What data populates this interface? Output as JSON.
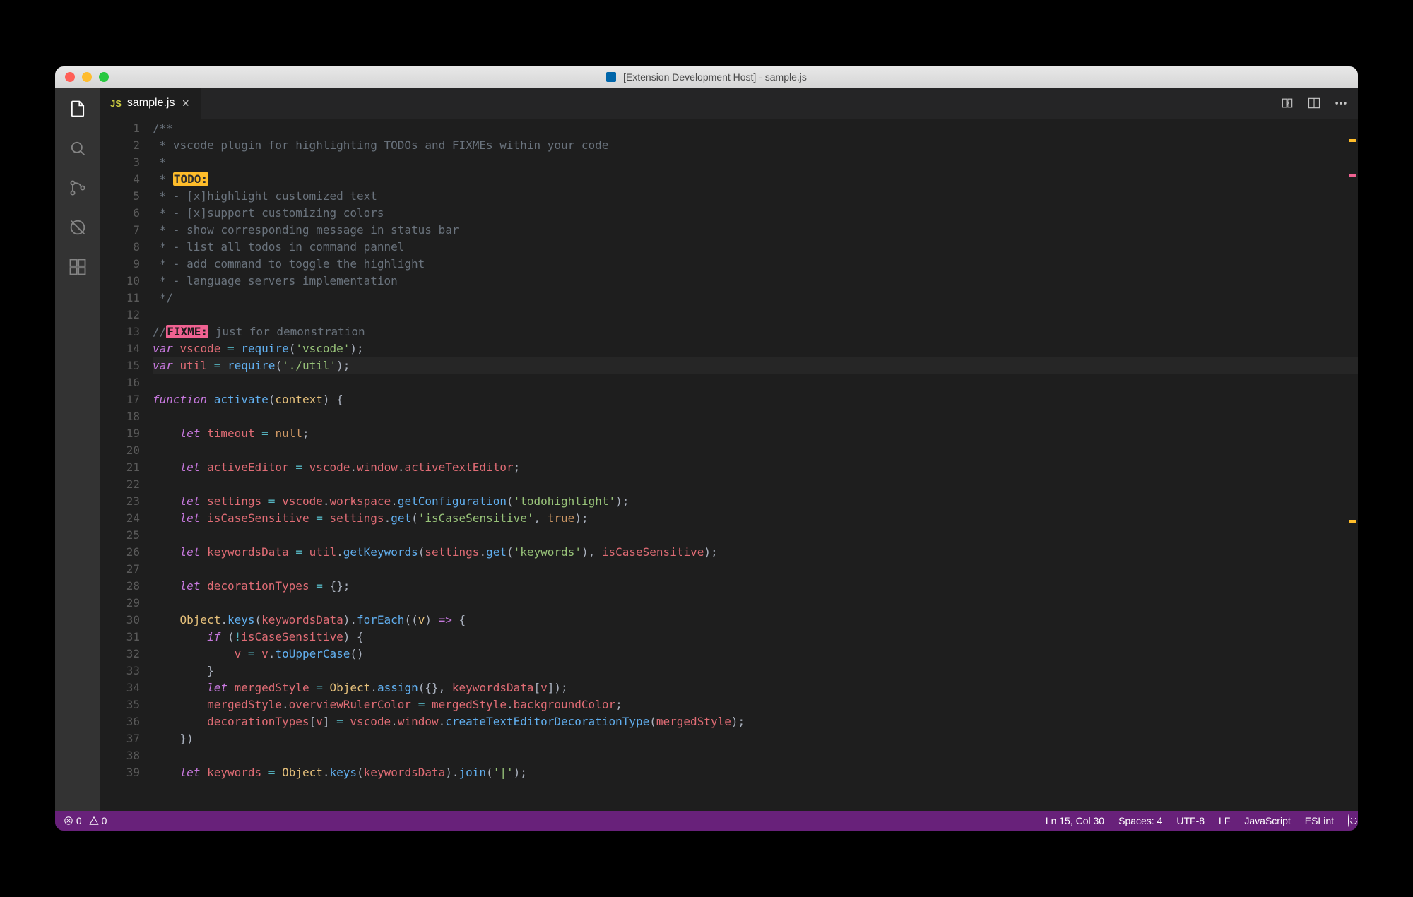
{
  "window": {
    "title": "[Extension Development Host] - sample.js"
  },
  "activitybar": {
    "items": [
      {
        "name": "explorer-icon"
      },
      {
        "name": "search-icon"
      },
      {
        "name": "source-control-icon"
      },
      {
        "name": "debug-icon"
      },
      {
        "name": "extensions-icon"
      }
    ]
  },
  "tabs": [
    {
      "icon": "JS",
      "label": "sample.js",
      "active": true
    }
  ],
  "editor_actions": [
    "compare-icon",
    "split-icon",
    "more-icon"
  ],
  "editor": {
    "current_line": 15,
    "lines": [
      {
        "n": 1,
        "tokens": [
          [
            "comment",
            "/**"
          ]
        ]
      },
      {
        "n": 2,
        "tokens": [
          [
            "comment",
            " * vscode plugin for highlighting TODOs and FIXMEs within your code"
          ]
        ]
      },
      {
        "n": 3,
        "tokens": [
          [
            "comment",
            " *"
          ]
        ]
      },
      {
        "n": 4,
        "tokens": [
          [
            "comment",
            " * "
          ],
          [
            "todo",
            "TODO:"
          ]
        ]
      },
      {
        "n": 5,
        "tokens": [
          [
            "comment",
            " * - [x]highlight customized text"
          ]
        ]
      },
      {
        "n": 6,
        "tokens": [
          [
            "comment",
            " * - [x]support customizing colors"
          ]
        ]
      },
      {
        "n": 7,
        "tokens": [
          [
            "comment",
            " * - show corresponding message in status bar"
          ]
        ]
      },
      {
        "n": 8,
        "tokens": [
          [
            "comment",
            " * - list all todos in command pannel"
          ]
        ]
      },
      {
        "n": 9,
        "tokens": [
          [
            "comment",
            " * - add command to toggle the highlight"
          ]
        ]
      },
      {
        "n": 10,
        "tokens": [
          [
            "comment",
            " * - language servers implementation"
          ]
        ]
      },
      {
        "n": 11,
        "tokens": [
          [
            "comment",
            " */"
          ]
        ]
      },
      {
        "n": 12,
        "tokens": []
      },
      {
        "n": 13,
        "tokens": [
          [
            "comment",
            "//"
          ],
          [
            "fixme",
            "FIXME:"
          ],
          [
            "comment",
            " just for demonstration"
          ]
        ]
      },
      {
        "n": 14,
        "tokens": [
          [
            "kw",
            "var"
          ],
          [
            "p",
            " "
          ],
          [
            "id",
            "vscode"
          ],
          [
            "p",
            " "
          ],
          [
            "op",
            "="
          ],
          [
            "p",
            " "
          ],
          [
            "fn",
            "require"
          ],
          [
            "p",
            "("
          ],
          [
            "str",
            "'vscode'"
          ],
          [
            "p",
            ");"
          ]
        ]
      },
      {
        "n": 15,
        "tokens": [
          [
            "kw",
            "var"
          ],
          [
            "p",
            " "
          ],
          [
            "id",
            "util"
          ],
          [
            "p",
            " "
          ],
          [
            "op",
            "="
          ],
          [
            "p",
            " "
          ],
          [
            "fn",
            "require"
          ],
          [
            "p",
            "("
          ],
          [
            "str",
            "'./util'"
          ],
          [
            "p",
            ");"
          ]
        ]
      },
      {
        "n": 16,
        "tokens": []
      },
      {
        "n": 17,
        "tokens": [
          [
            "kw",
            "function"
          ],
          [
            "p",
            " "
          ],
          [
            "fn",
            "activate"
          ],
          [
            "p",
            "("
          ],
          [
            "param",
            "context"
          ],
          [
            "p",
            ") {"
          ]
        ]
      },
      {
        "n": 18,
        "tokens": []
      },
      {
        "n": 19,
        "tokens": [
          [
            "p",
            "    "
          ],
          [
            "kw",
            "let"
          ],
          [
            "p",
            " "
          ],
          [
            "id",
            "timeout"
          ],
          [
            "p",
            " "
          ],
          [
            "op",
            "="
          ],
          [
            "p",
            " "
          ],
          [
            "lit",
            "null"
          ],
          [
            "p",
            ";"
          ]
        ]
      },
      {
        "n": 20,
        "tokens": []
      },
      {
        "n": 21,
        "tokens": [
          [
            "p",
            "    "
          ],
          [
            "kw",
            "let"
          ],
          [
            "p",
            " "
          ],
          [
            "id",
            "activeEditor"
          ],
          [
            "p",
            " "
          ],
          [
            "op",
            "="
          ],
          [
            "p",
            " "
          ],
          [
            "id",
            "vscode"
          ],
          [
            "p",
            "."
          ],
          [
            "id",
            "window"
          ],
          [
            "p",
            "."
          ],
          [
            "id",
            "activeTextEditor"
          ],
          [
            "p",
            ";"
          ]
        ]
      },
      {
        "n": 22,
        "tokens": []
      },
      {
        "n": 23,
        "tokens": [
          [
            "p",
            "    "
          ],
          [
            "kw",
            "let"
          ],
          [
            "p",
            " "
          ],
          [
            "id",
            "settings"
          ],
          [
            "p",
            " "
          ],
          [
            "op",
            "="
          ],
          [
            "p",
            " "
          ],
          [
            "id",
            "vscode"
          ],
          [
            "p",
            "."
          ],
          [
            "id",
            "workspace"
          ],
          [
            "p",
            "."
          ],
          [
            "fn",
            "getConfiguration"
          ],
          [
            "p",
            "("
          ],
          [
            "str",
            "'todohighlight'"
          ],
          [
            "p",
            ");"
          ]
        ]
      },
      {
        "n": 24,
        "tokens": [
          [
            "p",
            "    "
          ],
          [
            "kw",
            "let"
          ],
          [
            "p",
            " "
          ],
          [
            "id",
            "isCaseSensitive"
          ],
          [
            "p",
            " "
          ],
          [
            "op",
            "="
          ],
          [
            "p",
            " "
          ],
          [
            "id",
            "settings"
          ],
          [
            "p",
            "."
          ],
          [
            "fn",
            "get"
          ],
          [
            "p",
            "("
          ],
          [
            "str",
            "'isCaseSensitive'"
          ],
          [
            "p",
            ", "
          ],
          [
            "lit",
            "true"
          ],
          [
            "p",
            ");"
          ]
        ]
      },
      {
        "n": 25,
        "tokens": []
      },
      {
        "n": 26,
        "tokens": [
          [
            "p",
            "    "
          ],
          [
            "kw",
            "let"
          ],
          [
            "p",
            " "
          ],
          [
            "id",
            "keywordsData"
          ],
          [
            "p",
            " "
          ],
          [
            "op",
            "="
          ],
          [
            "p",
            " "
          ],
          [
            "id",
            "util"
          ],
          [
            "p",
            "."
          ],
          [
            "fn",
            "getKeywords"
          ],
          [
            "p",
            "("
          ],
          [
            "id",
            "settings"
          ],
          [
            "p",
            "."
          ],
          [
            "fn",
            "get"
          ],
          [
            "p",
            "("
          ],
          [
            "str",
            "'keywords'"
          ],
          [
            "p",
            "), "
          ],
          [
            "id",
            "isCaseSensitive"
          ],
          [
            "p",
            ");"
          ]
        ]
      },
      {
        "n": 27,
        "tokens": []
      },
      {
        "n": 28,
        "tokens": [
          [
            "p",
            "    "
          ],
          [
            "kw",
            "let"
          ],
          [
            "p",
            " "
          ],
          [
            "id",
            "decorationTypes"
          ],
          [
            "p",
            " "
          ],
          [
            "op",
            "="
          ],
          [
            "p",
            " {};"
          ]
        ]
      },
      {
        "n": 29,
        "tokens": []
      },
      {
        "n": 30,
        "tokens": [
          [
            "p",
            "    "
          ],
          [
            "id2",
            "Object"
          ],
          [
            "p",
            "."
          ],
          [
            "fn",
            "keys"
          ],
          [
            "p",
            "("
          ],
          [
            "id",
            "keywordsData"
          ],
          [
            "p",
            ")."
          ],
          [
            "fn",
            "forEach"
          ],
          [
            "p",
            "(("
          ],
          [
            "param",
            "v"
          ],
          [
            "p",
            ") "
          ],
          [
            "kw",
            "=>"
          ],
          [
            "p",
            " {"
          ]
        ]
      },
      {
        "n": 31,
        "tokens": [
          [
            "p",
            "        "
          ],
          [
            "kw",
            "if"
          ],
          [
            "p",
            " ("
          ],
          [
            "op",
            "!"
          ],
          [
            "id",
            "isCaseSensitive"
          ],
          [
            "p",
            ") {"
          ]
        ]
      },
      {
        "n": 32,
        "tokens": [
          [
            "p",
            "            "
          ],
          [
            "id",
            "v"
          ],
          [
            "p",
            " "
          ],
          [
            "op",
            "="
          ],
          [
            "p",
            " "
          ],
          [
            "id",
            "v"
          ],
          [
            "p",
            "."
          ],
          [
            "fn",
            "toUpperCase"
          ],
          [
            "p",
            "()"
          ]
        ]
      },
      {
        "n": 33,
        "tokens": [
          [
            "p",
            "        }"
          ]
        ]
      },
      {
        "n": 34,
        "tokens": [
          [
            "p",
            "        "
          ],
          [
            "kw",
            "let"
          ],
          [
            "p",
            " "
          ],
          [
            "id",
            "mergedStyle"
          ],
          [
            "p",
            " "
          ],
          [
            "op",
            "="
          ],
          [
            "p",
            " "
          ],
          [
            "id2",
            "Object"
          ],
          [
            "p",
            "."
          ],
          [
            "fn",
            "assign"
          ],
          [
            "p",
            "({}, "
          ],
          [
            "id",
            "keywordsData"
          ],
          [
            "p",
            "["
          ],
          [
            "id",
            "v"
          ],
          [
            "p",
            "]);"
          ]
        ]
      },
      {
        "n": 35,
        "tokens": [
          [
            "p",
            "        "
          ],
          [
            "id",
            "mergedStyle"
          ],
          [
            "p",
            "."
          ],
          [
            "id",
            "overviewRulerColor"
          ],
          [
            "p",
            " "
          ],
          [
            "op",
            "="
          ],
          [
            "p",
            " "
          ],
          [
            "id",
            "mergedStyle"
          ],
          [
            "p",
            "."
          ],
          [
            "id",
            "backgroundColor"
          ],
          [
            "p",
            ";"
          ]
        ]
      },
      {
        "n": 36,
        "tokens": [
          [
            "p",
            "        "
          ],
          [
            "id",
            "decorationTypes"
          ],
          [
            "p",
            "["
          ],
          [
            "id",
            "v"
          ],
          [
            "p",
            "] "
          ],
          [
            "op",
            "="
          ],
          [
            "p",
            " "
          ],
          [
            "id",
            "vscode"
          ],
          [
            "p",
            "."
          ],
          [
            "id",
            "window"
          ],
          [
            "p",
            "."
          ],
          [
            "fn",
            "createTextEditorDecorationType"
          ],
          [
            "p",
            "("
          ],
          [
            "id",
            "mergedStyle"
          ],
          [
            "p",
            ");"
          ]
        ]
      },
      {
        "n": 37,
        "tokens": [
          [
            "p",
            "    })"
          ]
        ]
      },
      {
        "n": 38,
        "tokens": []
      },
      {
        "n": 39,
        "tokens": [
          [
            "p",
            "    "
          ],
          [
            "kw",
            "let"
          ],
          [
            "p",
            " "
          ],
          [
            "id",
            "keywords"
          ],
          [
            "p",
            " "
          ],
          [
            "op",
            "="
          ],
          [
            "p",
            " "
          ],
          [
            "id2",
            "Object"
          ],
          [
            "p",
            "."
          ],
          [
            "fn",
            "keys"
          ],
          [
            "p",
            "("
          ],
          [
            "id",
            "keywordsData"
          ],
          [
            "p",
            ")."
          ],
          [
            "fn",
            "join"
          ],
          [
            "p",
            "("
          ],
          [
            "str",
            "'|'"
          ],
          [
            "p",
            ");"
          ]
        ]
      }
    ]
  },
  "minimap_marks": [
    {
      "top_pct": 3,
      "color": "#ffbd2a"
    },
    {
      "top_pct": 8,
      "color": "#f06292"
    },
    {
      "top_pct": 58,
      "color": "#ffbd2a"
    }
  ],
  "statusbar": {
    "errors": "0",
    "warnings": "0",
    "position": "Ln 15, Col 30",
    "spaces": "Spaces: 4",
    "encoding": "UTF-8",
    "eol": "LF",
    "language": "JavaScript",
    "lint": "ESLint"
  },
  "colors": {
    "statusbar": "#68217a",
    "todo_bg": "#ffbd2a",
    "fixme_bg": "#f06292"
  }
}
